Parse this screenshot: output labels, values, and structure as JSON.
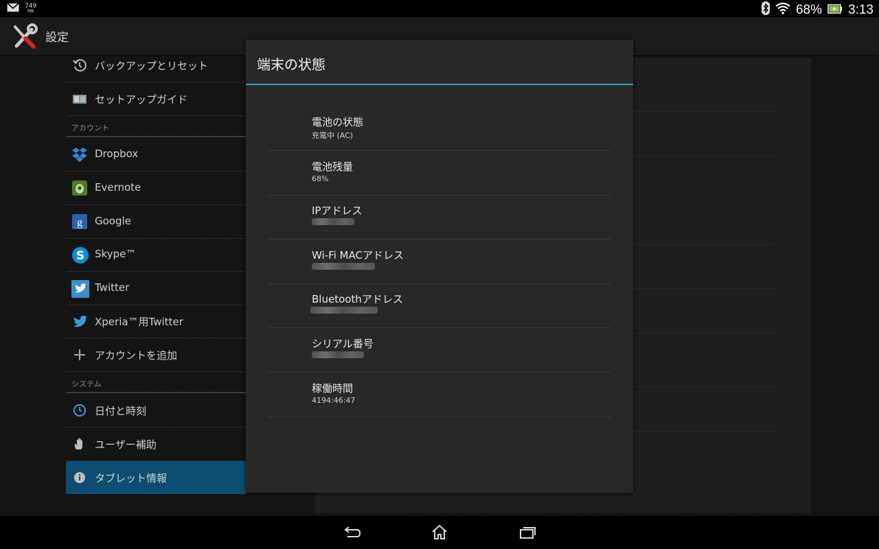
{
  "status_bar": {
    "memory_value": "749",
    "memory_unit": "MB",
    "battery_percent": "68%",
    "time": "3:13"
  },
  "action_bar": {
    "title": "設定"
  },
  "sidebar": {
    "items_top": [
      {
        "label": "バックアップとリセット",
        "icon": "backup-icon"
      },
      {
        "label": "セットアップガイド",
        "icon": "setup-guide-icon"
      }
    ],
    "section_accounts": "アカウント",
    "accounts": [
      {
        "label": "Dropbox",
        "icon": "dropbox-icon"
      },
      {
        "label": "Evernote",
        "icon": "evernote-icon"
      },
      {
        "label": "Google",
        "icon": "google-icon"
      },
      {
        "label": "Skype™",
        "icon": "skype-icon"
      },
      {
        "label": "Twitter",
        "icon": "twitter-icon"
      },
      {
        "label": "Xperia™用Twitter",
        "icon": "twitter-bird-icon"
      },
      {
        "label": "アカウントを追加",
        "icon": "add-icon"
      }
    ],
    "section_system": "システム",
    "system": [
      {
        "label": "日付と時刻",
        "icon": "clock-icon"
      },
      {
        "label": "ユーザー補助",
        "icon": "hand-icon"
      },
      {
        "label": "タブレット情報",
        "icon": "info-icon",
        "selected": true
      }
    ]
  },
  "dialog": {
    "title": "端末の状態",
    "items": [
      {
        "title": "電池の状態",
        "summary": "充電中 (AC)"
      },
      {
        "title": "電池残量",
        "summary": "68%"
      },
      {
        "title": "IPアドレス",
        "summary": ""
      },
      {
        "title": "Wi-Fi MACアドレス",
        "summary": ""
      },
      {
        "title": "Bluetoothアドレス",
        "summary": ""
      },
      {
        "title": "シリアル番号",
        "summary": ""
      },
      {
        "title": "稼働時間",
        "summary": "4194:46:47"
      }
    ]
  },
  "colors": {
    "accent": "#2f9bd1",
    "selected_bg": "#0d4d73"
  }
}
